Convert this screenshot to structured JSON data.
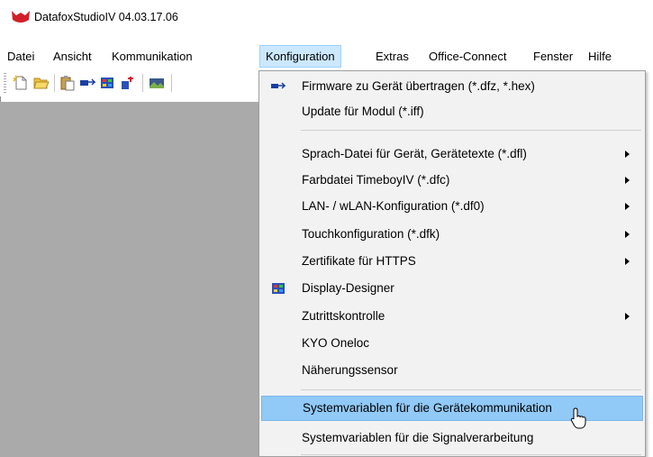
{
  "window": {
    "title": "DatafoxStudioIV 04.03.17.06"
  },
  "menubar": {
    "items": [
      {
        "label": "Datei"
      },
      {
        "label": "Ansicht"
      },
      {
        "label": "Kommunikation"
      },
      {
        "label": "Konfiguration"
      },
      {
        "label": "Extras"
      },
      {
        "label": "Office-Connect"
      },
      {
        "label": "Fenster"
      },
      {
        "label": "Hilfe"
      }
    ]
  },
  "toolbar": {
    "buttons": [
      {
        "icon": "new-file-icon"
      },
      {
        "icon": "open-folder-icon"
      },
      {
        "icon": "paste-icon"
      },
      {
        "icon": "device-transfer-icon"
      },
      {
        "icon": "display-designer-icon"
      },
      {
        "icon": "network-icon"
      },
      {
        "icon": "image-icon"
      }
    ]
  },
  "dropdown": {
    "items": [
      {
        "label": "Firmware zu Gerät übertragen (*.dfz, *.hex)",
        "icon": "device-transfer-icon"
      },
      {
        "label": "Update für Modul (*.iff)"
      },
      {
        "label": "Sprach-Datei für Gerät, Gerätetexte (*.dfl)",
        "submenu": true
      },
      {
        "label": "Farbdatei TimeboyIV (*.dfc)",
        "submenu": true
      },
      {
        "label": "LAN- / wLAN-Konfiguration (*.df0)",
        "submenu": true
      },
      {
        "label": "Touchkonfiguration (*.dfk)",
        "submenu": true
      },
      {
        "label": "Zertifikate für HTTPS",
        "submenu": true
      },
      {
        "label": "Display-Designer",
        "icon": "display-designer-icon"
      },
      {
        "label": "Zutrittskontrolle",
        "submenu": true
      },
      {
        "label": "KYO Oneloc"
      },
      {
        "label": "Näherungssensor"
      },
      {
        "label": "Systemvariablen für die Gerätekommunikation",
        "highlighted": true
      },
      {
        "label": "Systemvariablen für die Signalverarbeitung"
      }
    ]
  },
  "colors": {
    "menu_active_bg": "#cce8ff",
    "item_highlight_bg": "#91c9f7",
    "workspace_bg": "#aaaaaa",
    "dropdown_bg": "#f2f2f2"
  }
}
